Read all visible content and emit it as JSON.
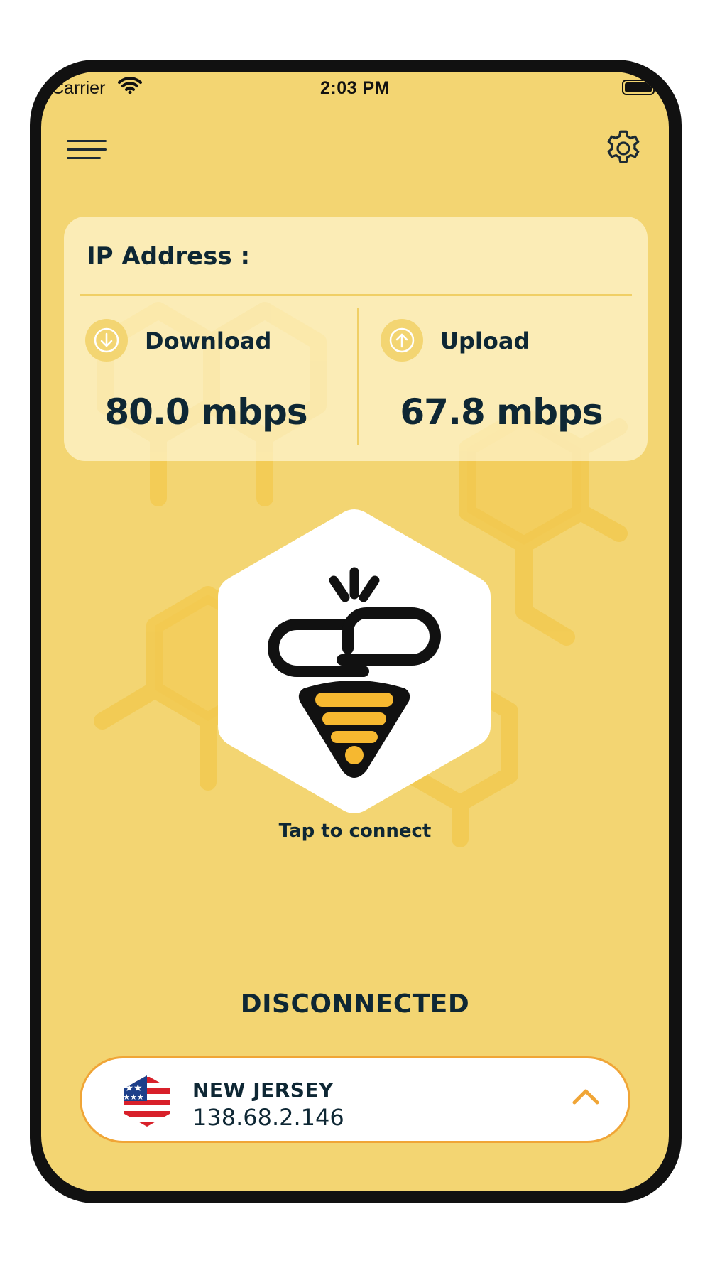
{
  "status_bar": {
    "carrier": "Carrier",
    "time": "2:03 PM"
  },
  "header": {
    "menu_icon": "hamburger-menu-icon",
    "settings_icon": "gear-icon"
  },
  "stats_card": {
    "ip_label": "IP Address :",
    "download": {
      "label": "Download",
      "value": "80.0 mbps",
      "icon": "arrow-down-circle-icon"
    },
    "upload": {
      "label": "Upload",
      "value": "67.8 mbps",
      "icon": "arrow-up-circle-icon"
    }
  },
  "connect": {
    "icon": "bee-link-icon",
    "tap_text": "Tap to connect",
    "status": "DISCONNECTED"
  },
  "server": {
    "name": "NEW JERSEY",
    "ip": "138.68.2.146",
    "flag_icon": "us-flag-icon",
    "expand_icon": "chevron-up-icon"
  },
  "colors": {
    "background": "#f3d572",
    "accent": "#f0a536",
    "text": "#0e2734",
    "bee_yellow": "#f6b830"
  }
}
